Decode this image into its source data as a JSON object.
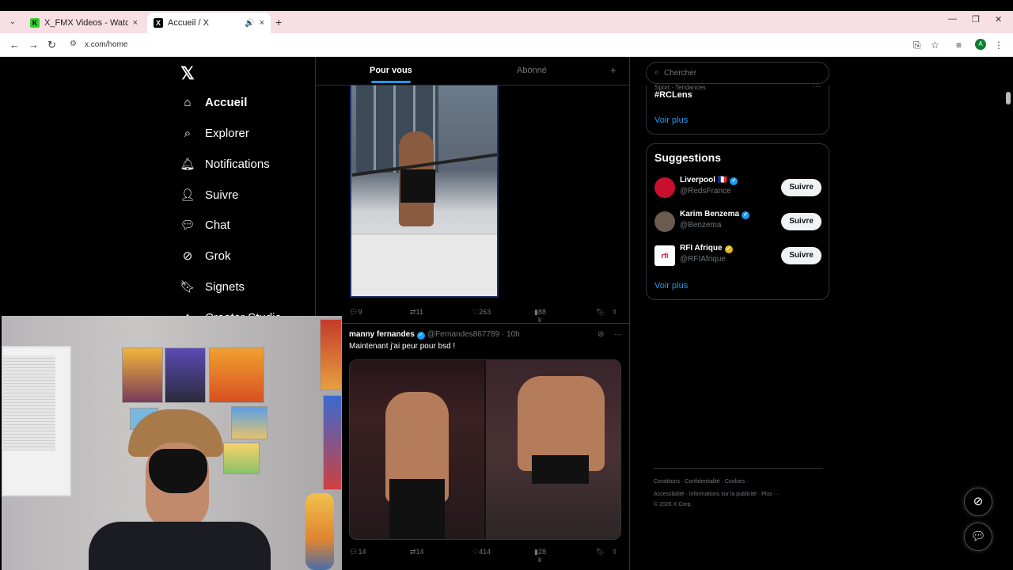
{
  "browser": {
    "tabs": [
      {
        "title": "X_FMX Videos - Watch On-Den",
        "favicon": "K",
        "close": "×"
      },
      {
        "title": "Accueil / X",
        "favicon": "X",
        "audio": "🔊",
        "close": "×"
      }
    ],
    "new_tab": "+",
    "url": "x.com/home",
    "profile_initial": "A"
  },
  "sidebar": {
    "logo": "𝕏",
    "items": [
      {
        "label": "Accueil",
        "icon": "home-icon",
        "glyph": "⌂"
      },
      {
        "label": "Explorer",
        "icon": "search-icon",
        "glyph": "⌕"
      },
      {
        "label": "Notifications",
        "icon": "bell-icon",
        "glyph": "🔔︎"
      },
      {
        "label": "Suivre",
        "icon": "follow-icon",
        "glyph": "👤︎"
      },
      {
        "label": "Chat",
        "icon": "chat-icon",
        "glyph": "💬︎"
      },
      {
        "label": "Grok",
        "icon": "grok-icon",
        "glyph": "⊘"
      },
      {
        "label": "Signets",
        "icon": "bookmark-icon",
        "glyph": "🔖︎"
      },
      {
        "label": "Creator Studio",
        "icon": "creator-icon",
        "glyph": "✦"
      }
    ]
  },
  "feed": {
    "tabs": {
      "selected": "Pour vous",
      "other": "Abonné",
      "plus": "+"
    },
    "post1": {
      "replies": "9",
      "reposts": "11",
      "likes": "263",
      "views": "88 k"
    },
    "post2": {
      "name": "manny fernandes",
      "handle": "@Fernandes867789",
      "time": "· 10h",
      "text": "Maintenant j'ai peur pour bsd !",
      "replies": "14",
      "reposts": "14",
      "likes": "414",
      "views": "28 k"
    }
  },
  "right": {
    "search_placeholder": "Chercher",
    "trend_meta": "Sport · Tendances",
    "trend_tag": "#RCLens",
    "see_more": "Voir plus",
    "suggestions_title": "Suggestions",
    "suggestions": [
      {
        "name": "Liverpool",
        "flag": "🇫🇷",
        "handle": "@RedsFrance",
        "button": "Suivre",
        "avatar_color": "#c8102e"
      },
      {
        "name": "Karim Benzema",
        "handle": "@Benzema",
        "button": "Suivre",
        "avatar_color": "#6b5a4e"
      },
      {
        "name": "RFI Afrique",
        "handle": "@RFIAfrique",
        "button": "Suivre",
        "avatar_color": "#ffffff"
      }
    ],
    "suggestions_more": "Voir plus",
    "footer": {
      "line1": "Conditions · Confidentialité · Cookies ·",
      "line2": "Accessibilité · Informations sur la publicité · Plus ···",
      "line3": "© 2026 X Corp."
    }
  },
  "colors": {
    "accent": "#1d9bf0",
    "background": "#000000"
  }
}
